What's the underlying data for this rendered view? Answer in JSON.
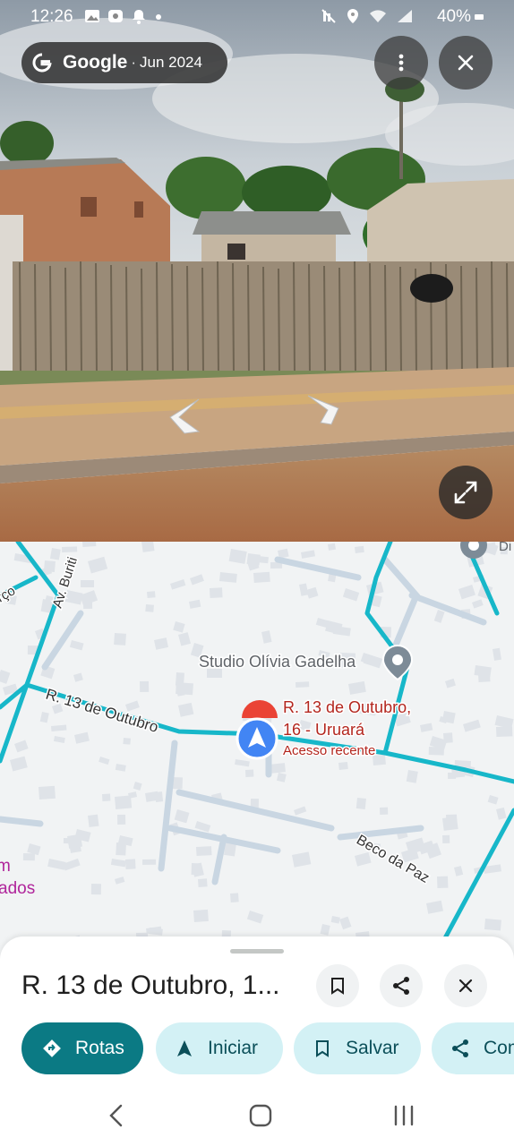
{
  "status_bar": {
    "time": "12:26",
    "battery": "40%",
    "left_icons": [
      "image-icon",
      "screen-record-icon",
      "notification-bell-icon",
      "dot-icon"
    ],
    "right_icons": [
      "mute-icon",
      "location-icon",
      "wifi-icon",
      "signal-icon"
    ]
  },
  "street_view": {
    "brand": "Google",
    "separator": "·",
    "date": "Jun 2024",
    "more_icon": "more-vert-icon",
    "close_icon": "close-icon",
    "expand_icon": "expand-icon"
  },
  "map": {
    "labels": {
      "studio": "Studio Olívia Gadelha",
      "pin_line1": "R. 13 de Outubro,",
      "pin_line2": "16 - Uruará",
      "pin_line3": "Acesso recente",
      "street_13": "R. 13 de Outubro",
      "beco": "Beco da Paz",
      "av_buriti": "Av. Buriti",
      "rco": "rço",
      "m": "m",
      "ados": "ados",
      "di": "Di"
    },
    "colors": {
      "main_road": "#17b7c9",
      "minor_road": "#c9d6e2",
      "poi_text": "#5f6368",
      "pin_red": "#ea4335",
      "location_blue": "#4285f4",
      "magenta_text": "#b0259b"
    }
  },
  "sheet": {
    "title": "R. 13 de Outubro, 1...",
    "buttons": {
      "bookmark_icon": "bookmark-icon",
      "share_icon": "share-icon",
      "close_icon": "close-icon"
    },
    "chips": [
      {
        "label": "Rotas",
        "icon": "directions-icon"
      },
      {
        "label": "Iniciar",
        "icon": "navigation-icon"
      },
      {
        "label": "Salvar",
        "icon": "bookmark-icon"
      },
      {
        "label": "Com",
        "icon": "share-icon"
      }
    ]
  },
  "nav_bar": {
    "icons": [
      "back-icon",
      "home-icon",
      "recents-icon"
    ]
  }
}
